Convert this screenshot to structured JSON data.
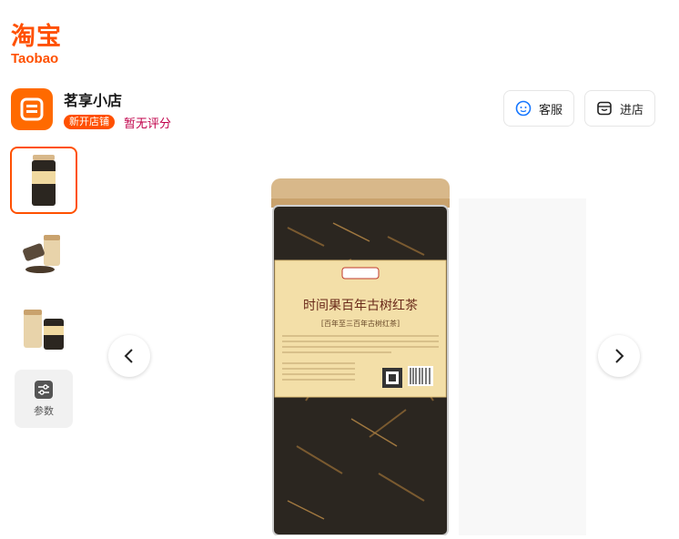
{
  "logo": {
    "cn": "淘宝",
    "en": "Taobao"
  },
  "shop": {
    "name": "茗享小店",
    "badge": "新开店铺",
    "rating": "暂无评分",
    "service_label": "客服",
    "store_label": "进店"
  },
  "gallery": {
    "thumbnails": [
      "product-front",
      "product-side",
      "product-pack"
    ],
    "active_index": 0,
    "params_label": "参数"
  },
  "product_label": {
    "title": "时间果百年古树红茶",
    "subtitle": "[百年至三百年古树红茶]"
  },
  "colors": {
    "accent": "#ff5000",
    "rating": "#c0004a",
    "bamboo": "#d8b88a"
  }
}
